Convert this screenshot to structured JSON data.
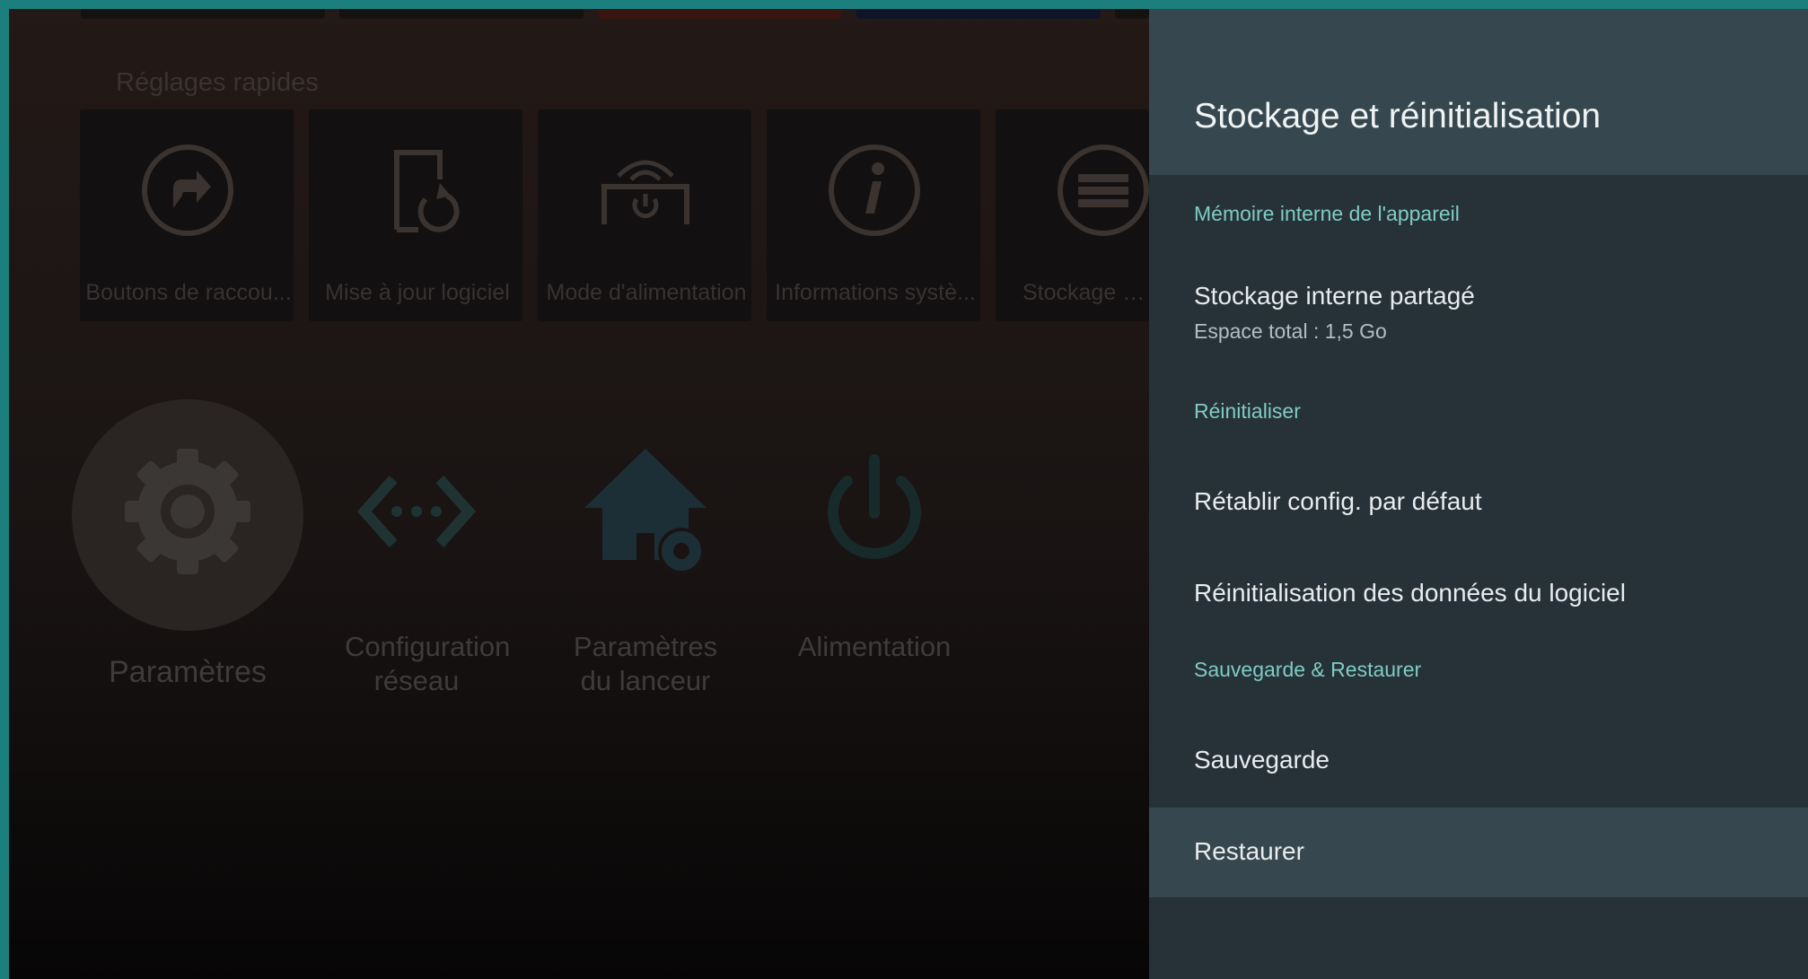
{
  "launcher": {
    "section_title": "Réglages rapides",
    "top_strip_colors": [
      "#141111",
      "#141111",
      "#3a1410",
      "#0f1428",
      "#141111"
    ],
    "tiles": [
      {
        "label": "Boutons de raccou...",
        "icon": "shortcut-icon"
      },
      {
        "label": "Mise à jour logiciel",
        "icon": "system-update-icon"
      },
      {
        "label": "Mode d'alimentation",
        "icon": "power-mode-icon"
      },
      {
        "label": "Informations systè...",
        "icon": "info-icon"
      },
      {
        "label": "Stockage rés",
        "icon": "storage-icon"
      }
    ],
    "apps": [
      {
        "label": "Paramètres",
        "icon": "gear-icon"
      },
      {
        "label": "Configuration réseau",
        "icon": "network-icon"
      },
      {
        "label": "Paramètres du lanceur",
        "icon": "launcher-settings-icon"
      },
      {
        "label": "Alimentation",
        "icon": "power-icon"
      }
    ]
  },
  "panel": {
    "title": "Stockage et réinitialisation",
    "groups": [
      {
        "header": "Mémoire interne de l'appareil",
        "items": [
          {
            "title": "Stockage interne partagé",
            "subtitle": "Espace total : 1,5 Go"
          }
        ]
      },
      {
        "header": "Réinitialiser",
        "items": [
          {
            "title": "Rétablir config. par défaut"
          },
          {
            "title": "Réinitialisation des données du logiciel"
          }
        ]
      },
      {
        "header": "Sauvegarde & Restaurer",
        "items": [
          {
            "title": "Sauvegarde"
          },
          {
            "title": "Restaurer",
            "selected": true
          }
        ]
      }
    ]
  },
  "colors": {
    "frame": "#1a7f7d",
    "panel_bg": "#263238",
    "panel_header_bg": "#37474f",
    "accent": "#80cbc4",
    "selected_row": "#37474f"
  }
}
